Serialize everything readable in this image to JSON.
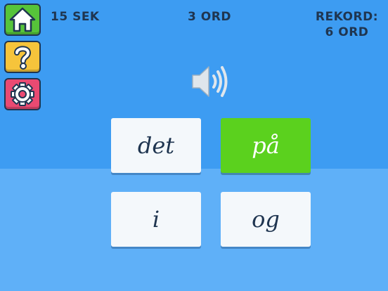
{
  "hud": {
    "time_label": "15 SEK",
    "words_label": "3 ORD",
    "record_title": "REKORD:",
    "record_value": "6 ORD"
  },
  "buttons": {
    "home_icon": "house-icon",
    "help_icon": "question-mark-icon",
    "settings_icon": "gear-icon"
  },
  "audio": {
    "icon": "speaker-icon"
  },
  "words": [
    {
      "text": "det",
      "state": "default"
    },
    {
      "text": "på",
      "state": "correct"
    },
    {
      "text": "i",
      "state": "default"
    },
    {
      "text": "og",
      "state": "default"
    }
  ],
  "colors": {
    "sky": "#3d9cf2",
    "floor": "#5fb0f8",
    "correct": "#5bd11e",
    "home": "#56c43a",
    "help": "#f6c43b",
    "settings": "#ea4a72",
    "text_dark": "#1f3550"
  }
}
